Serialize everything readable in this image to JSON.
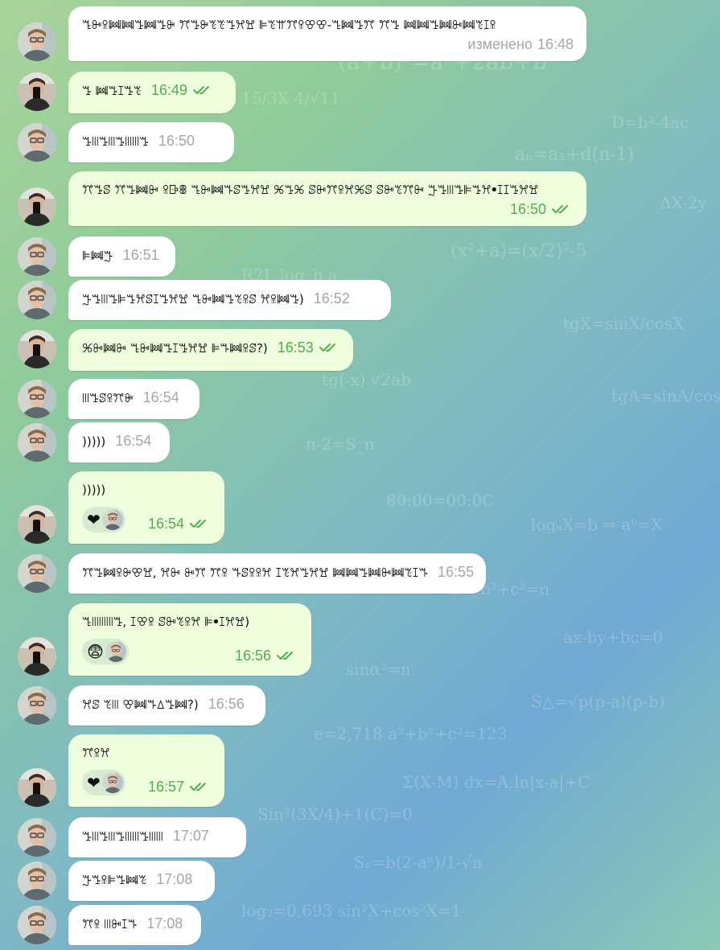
{
  "colors": {
    "incoming_bubble": "#ffffff",
    "outgoing_bubble": "#effedd",
    "time_in": "#a0a7ad",
    "time_out": "#4fae4e",
    "reaction_bg": "#d5ecd1"
  },
  "messages": [
    {
      "id": "m1",
      "dir": "in",
      "sender": "glasses",
      "text": "ꔎꔻꕉꔞꔞꔤꔞꔤꔭ ꔫꔤꔭꔳꔴꔤꕮꖏ ꕞꔳꕌꔫꕉꕢꕢ-ꔎꔞꔤꔫ ꔫꔤ ꔞꔞꔤꔞꔻꔞꔳꕯꕉ",
      "edited": "изменено",
      "time": "16:48"
    },
    {
      "id": "m2",
      "dir": "out",
      "sender": "phone",
      "text": "ꔤ ꔞꔤꕯꔤꔳ",
      "time": "16:49"
    },
    {
      "id": "m3",
      "dir": "in",
      "sender": "glasses",
      "text": "ꔤꔖꔤꔖꔤꔖꔖꔤ",
      "time": "16:50"
    },
    {
      "id": "m4",
      "dir": "out",
      "sender": "phone",
      "text": "ꔫꔤꕷ ꔫꔤꔞꔻ ꕉꕒꕬ ꔎꔻꔞꔒꕷꔤꕮꖏ ꕑꔤꕑ ꕷꔻꔫꕉꕮꕑꕷ ꕷꔻꔳꔫꔻ ꔓꔤꔖꔤꕞꔤꕮꔷꕯꕯꔤꕮꖏ",
      "time": "16:50"
    },
    {
      "id": "m5",
      "dir": "in",
      "sender": "glasses",
      "text": "ꕞꔞꔓ",
      "time": "16:51"
    },
    {
      "id": "m6",
      "dir": "in",
      "sender": "glasses",
      "text": "ꔓꔤꔖꔤꕞꔤꕮꕷꕯꔤꕮꖏ ꔎꔻꔞꔤꔳꕉꕷ ꕮꕉꔞꔤ)",
      "time": "16:52"
    },
    {
      "id": "m7",
      "dir": "out",
      "sender": "phone",
      "text": "ꕑꔻꔞꔻ ꔎꔻꔞꔤꕯꔤꕮꖏ ꕞꔒꔞꕉꕷ?)",
      "time": "16:53"
    },
    {
      "id": "m8",
      "dir": "in",
      "sender": "glasses",
      "text": "ꔖꔤꕷꕉꔫꔭ",
      "time": "16:54"
    },
    {
      "id": "m9",
      "dir": "in",
      "sender": "glasses",
      "text": ")))))",
      "time": "16:54"
    },
    {
      "id": "m10",
      "dir": "out",
      "sender": "phone",
      "text": ")))))",
      "time": "16:54",
      "reaction": "❤"
    },
    {
      "id": "m11",
      "dir": "in",
      "sender": "glasses",
      "text": "ꔫꔤꔞꕉꔭꕢꖏ, ꕮꔻ ꔻꔫ ꔫꕉ ꔒꕷꕉꕉꕮ ꕯꔳꕮꔤꕮꖏ ꔞꔞꔤꔞꔻꔞꔳꕯꔒ",
      "time": "16:55"
    },
    {
      "id": "m12",
      "dir": "out",
      "sender": "phone",
      "text": "ꔎꔖꔖꔖꔤ, ꕯꕢꕉ ꕷꔻꔳꕉꕮ ꕞꔷꕯꕮꖏ)",
      "time": "16:56",
      "reaction": "😨"
    },
    {
      "id": "m13",
      "dir": "in",
      "sender": "glasses",
      "text": "ꕮꕷ ꔳꔖ ꕢꔞꔒꕔꔤꔞ?)",
      "time": "16:56"
    },
    {
      "id": "m14",
      "dir": "out",
      "sender": "phone",
      "text": "ꔫꕉꕮ",
      "time": "16:57",
      "reaction": "❤"
    },
    {
      "id": "m15",
      "dir": "in",
      "sender": "glasses",
      "text": "ꔤꔖꔤꔖꔤꔖꔖꔤꔖꔖ",
      "time": "17:07"
    },
    {
      "id": "m16",
      "dir": "in",
      "sender": "glasses",
      "text": "ꔓꔤꕉꕞꔤꔞꔳ",
      "time": "17:08"
    },
    {
      "id": "m17",
      "dir": "in",
      "sender": "glasses",
      "text": "ꔫꕉ ꔖꔻꕯꔒ",
      "time": "17:08"
    }
  ]
}
